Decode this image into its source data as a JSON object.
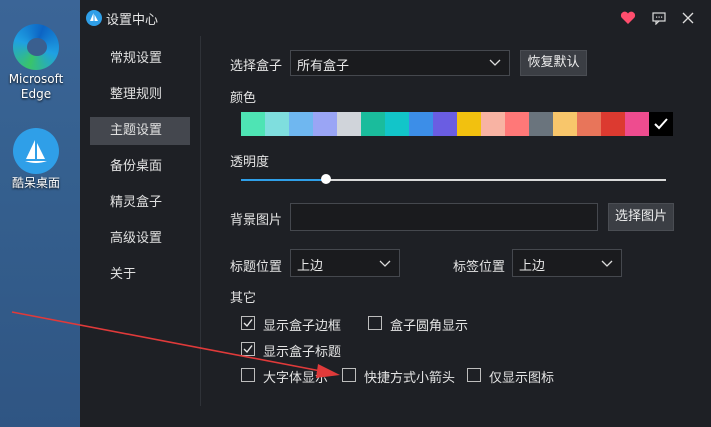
{
  "desktop": {
    "icons": [
      {
        "label_line1": "Microsoft",
        "label_line2": "Edge",
        "icon": "edge-icon"
      },
      {
        "label_line1": "酷呆桌面",
        "icon": "kuo-desktop-icon"
      }
    ]
  },
  "window": {
    "title": "设置中心",
    "buttons": [
      "heart-icon",
      "feedback-icon",
      "close-icon"
    ]
  },
  "sidebar": {
    "items": [
      {
        "label": "常规设置"
      },
      {
        "label": "整理规则"
      },
      {
        "label": "主题设置",
        "active": true
      },
      {
        "label": "备份桌面"
      },
      {
        "label": "精灵盒子"
      },
      {
        "label": "高级设置"
      },
      {
        "label": "关于"
      }
    ]
  },
  "theme": {
    "box_label": "选择盒子",
    "box_value": "所有盒子",
    "reset_label": "恢复默认",
    "color_label": "颜色",
    "colors": [
      "#4ee4b4",
      "#7fdede",
      "#6fb7f0",
      "#9aa5f5",
      "#d0d4da",
      "#1abc9c",
      "#12c5c9",
      "#3c8ee8",
      "#6a5de2",
      "#f2c10f",
      "#f8b3a3",
      "#ff7878",
      "#6a747d",
      "#f8c66b",
      "#e8755a",
      "#dc3a30",
      "#ee4c8f",
      "#000000"
    ],
    "selected_color_index": 17,
    "opacity_label": "透明度",
    "opacity": 0.2,
    "bg_image_label": "背景图片",
    "bg_image_value": "",
    "choose_image_label": "选择图片",
    "title_pos_label": "标题位置",
    "title_pos_value": "上边",
    "tag_pos_label": "标签位置",
    "tag_pos_value": "上边",
    "other_label": "其它",
    "options": [
      {
        "label": "显示盒子边框",
        "checked": true
      },
      {
        "label": "盒子圆角显示",
        "checked": false
      },
      {
        "label": "显示盒子标题",
        "checked": true
      },
      {
        "label": "大字体显示",
        "checked": false
      },
      {
        "label": "快捷方式小箭头",
        "checked": false
      },
      {
        "label": "仅显示图标",
        "checked": false
      }
    ]
  },
  "colors": {
    "window_bg": "#1e2025",
    "accent": "#2f9fe8",
    "annotation_arrow": "#e03a3a"
  }
}
